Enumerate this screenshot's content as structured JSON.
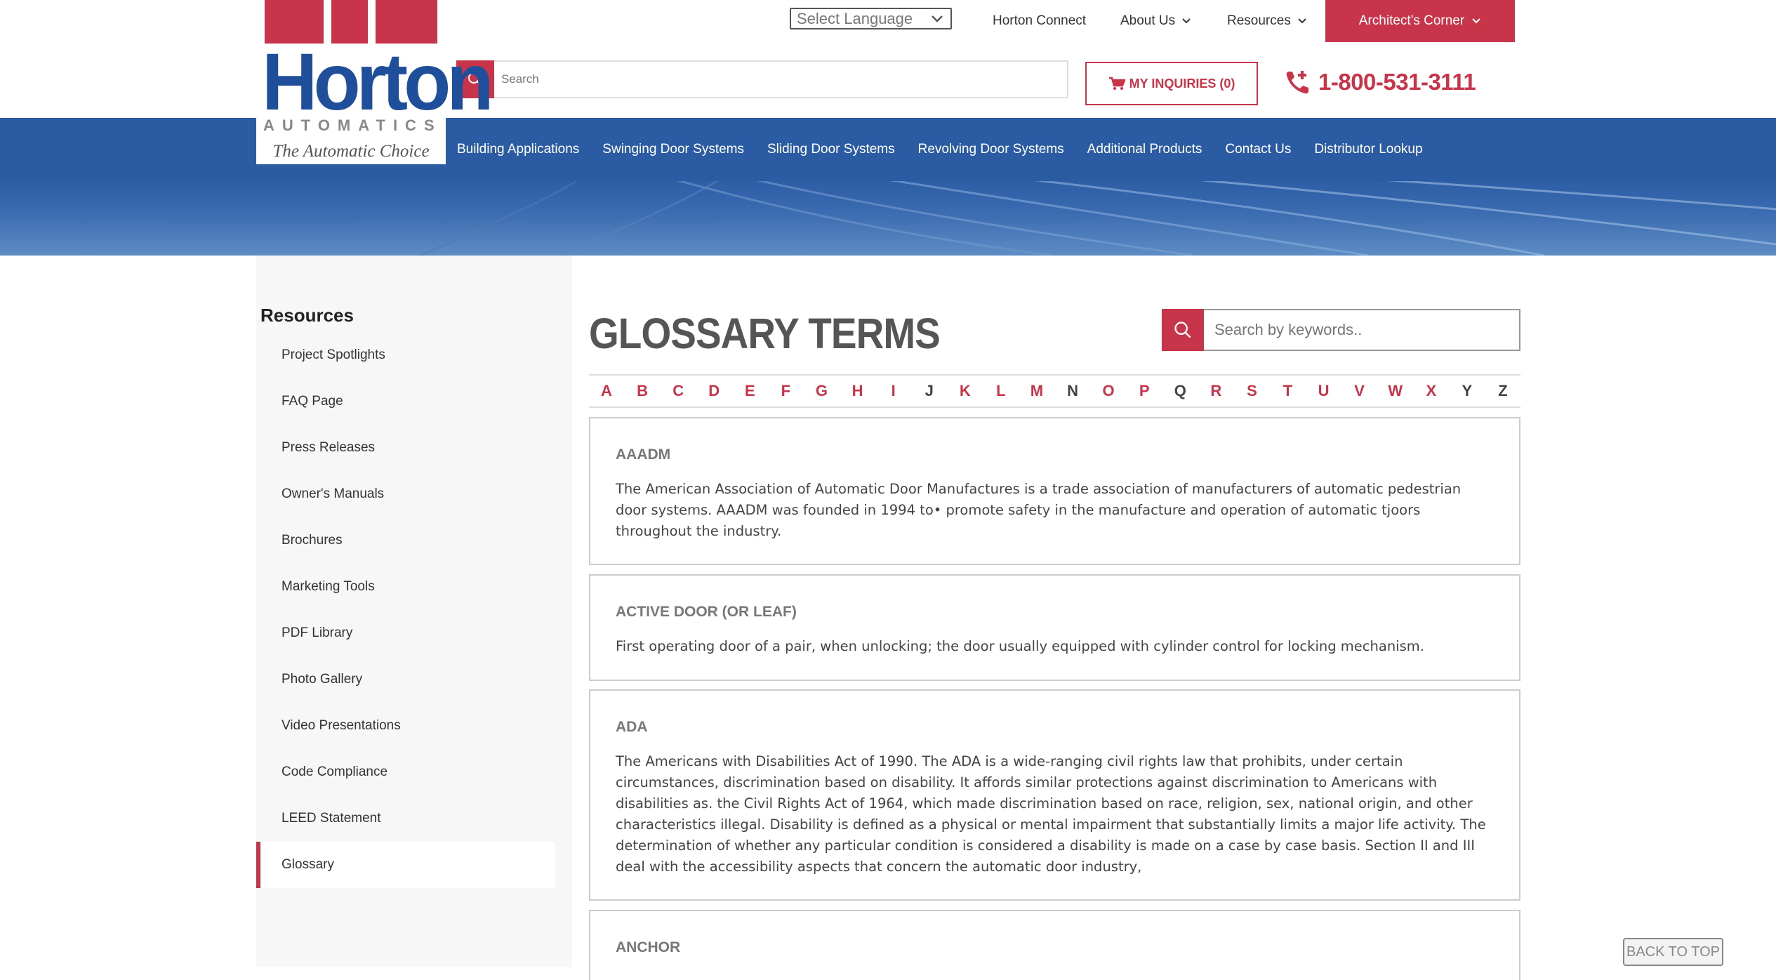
{
  "logo": {
    "word": "Horton",
    "sub": "AUTOMATICS",
    "tagline": "The Automatic Choice"
  },
  "language": {
    "label": "Select Language"
  },
  "topnav": {
    "horton_connect": "Horton Connect",
    "about_us": "About Us",
    "resources": "Resources",
    "architects_corner": "Architect's Corner"
  },
  "search": {
    "placeholder": "Search"
  },
  "inquiries": {
    "label": "MY INQUIRIES (0)"
  },
  "phone": {
    "number": "1-800-531-3111"
  },
  "mainnav": {
    "items": [
      "Building Applications",
      "Swinging Door Systems",
      "Sliding Door Systems",
      "Revolving Door Systems",
      "Additional Products",
      "Contact Us",
      "Distributor Lookup"
    ]
  },
  "sidebar": {
    "title": "Resources",
    "links": [
      "Project Spotlights",
      "FAQ Page",
      "Press Releases",
      "Owner's Manuals",
      "Brochures",
      "Marketing Tools",
      "PDF Library",
      "Photo Gallery",
      "Video Presentations",
      "Code Compliance",
      "LEED Statement",
      "Glossary"
    ],
    "active": "Glossary"
  },
  "glossary": {
    "title": "GLOSSARY TERMS",
    "search_placeholder": "Search by keywords..",
    "letters": [
      "A",
      "B",
      "C",
      "D",
      "E",
      "F",
      "G",
      "H",
      "I",
      "J",
      "K",
      "L",
      "M",
      "N",
      "O",
      "P",
      "Q",
      "R",
      "S",
      "T",
      "U",
      "V",
      "W",
      "X",
      "Y",
      "Z"
    ],
    "terms": [
      {
        "name": "AAADM",
        "desc": "The American Association of Automatic Door Manufactures is a trade association of manufacturers of automatic pedestrian door systems. AAADM was founded in 1994 to• promote safety in the manufacture and operation of automatic tjoors throughout the industry."
      },
      {
        "name": "ACTIVE DOOR (OR LEAF)",
        "desc": "First operating door of a pair, when unlocking; the door usually equipped with cylinder control for locking mechanism."
      },
      {
        "name": "ADA",
        "desc": "The Americans with Disabilities Act of 1990. The ADA is a wide-ranging civil rights law that prohibits, under certain circumstances, discrimination based on disability. It affords similar protections against discrimination to Americans with disabilities as. the Civil Rights Act of 1964, which made discrimination based on race, religion, sex, national origin, and other characteristics illegal. Disability is defined as a physical or mental impairment that substantially limits a major life activity. The determination of whether any particular condition is considered a disability is made on a case by case basis. Section II and III deal with the accessibility aspects that concern the automatic door industry,"
      },
      {
        "name": "ANCHOR",
        "desc": ""
      }
    ]
  },
  "back_to_top": "BACK TO TOP",
  "colors": {
    "brand_red": "#c8354a",
    "brand_blue": "#2b5ca3"
  }
}
